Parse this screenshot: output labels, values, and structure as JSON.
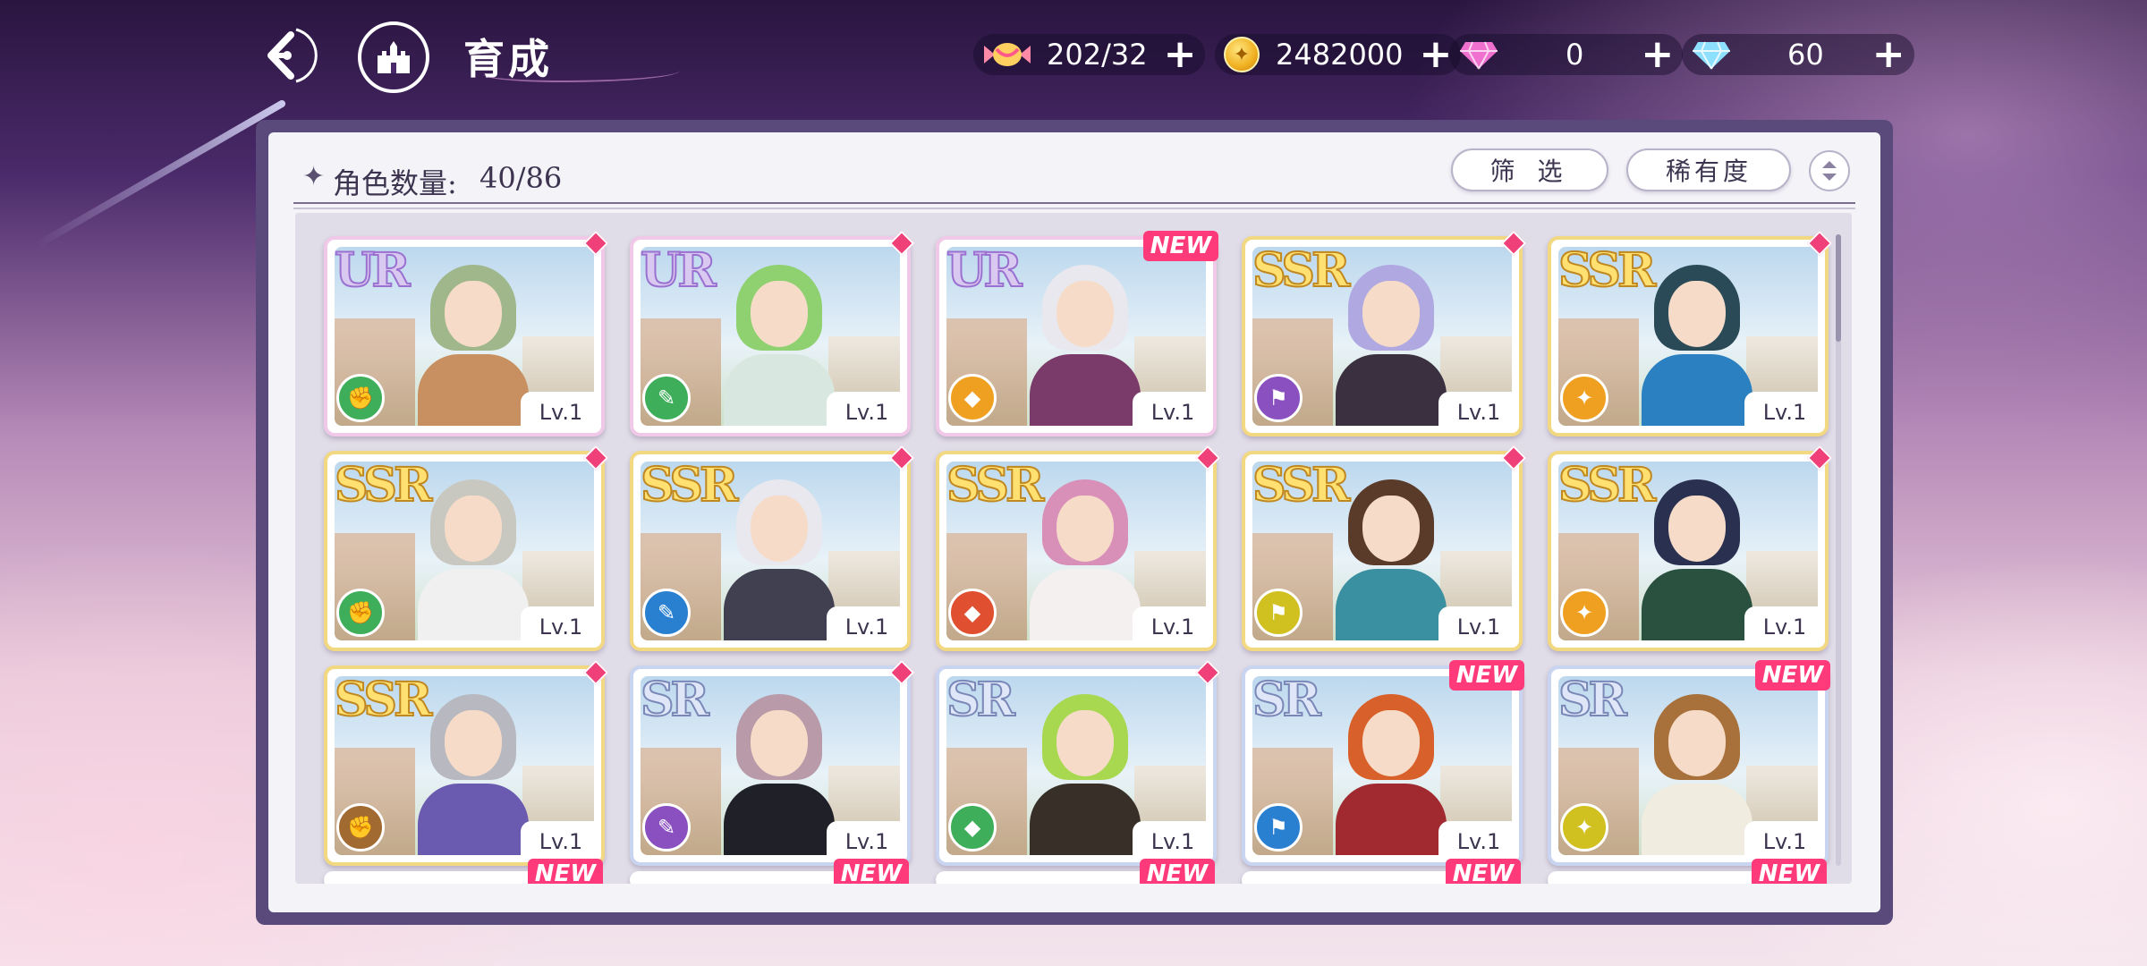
{
  "header": {
    "title": "育成",
    "resources": [
      {
        "name": "candy",
        "value": "202/32"
      },
      {
        "name": "coin",
        "value": "2482000"
      },
      {
        "name": "pink-gem",
        "value": "0"
      },
      {
        "name": "diamond",
        "value": "60"
      }
    ]
  },
  "panel": {
    "count_label": "角色数量:",
    "count_value": "40/86",
    "filter_label": "筛 选",
    "rarity_label": "稀有度"
  },
  "colors": {
    "ur_frame": "#f0c8e8",
    "ssr_frame": "#f2d880",
    "sr_frame": "#c8d4f0",
    "new_badge": "#ff3a7a"
  },
  "cards": [
    {
      "rarity": "UR",
      "level": "Lv.1",
      "hair": "#9fb78a",
      "body": "#c89060",
      "type_color": "#3fae5a",
      "marker": "gem"
    },
    {
      "rarity": "UR",
      "level": "Lv.1",
      "hair": "#8fd070",
      "body": "#d8e8e0",
      "type_color": "#3fae5a",
      "marker": "gem"
    },
    {
      "rarity": "UR",
      "level": "Lv.1",
      "hair": "#e8e8ee",
      "body": "#7a3a6a",
      "type_color": "#f0a020",
      "marker": "NEW"
    },
    {
      "rarity": "SSR",
      "level": "Lv.1",
      "hair": "#b0a8e0",
      "body": "#3a3040",
      "type_color": "#8a50c0",
      "marker": "gem"
    },
    {
      "rarity": "SSR",
      "level": "Lv.1",
      "hair": "#2a4a58",
      "body": "#2a80c0",
      "type_color": "#f0a020",
      "marker": "gem"
    },
    {
      "rarity": "SSR",
      "level": "Lv.1",
      "hair": "#c8c8c0",
      "body": "#f0f0f0",
      "type_color": "#3fae5a",
      "marker": "gem"
    },
    {
      "rarity": "SSR",
      "level": "Lv.1",
      "hair": "#e8e8ee",
      "body": "#404050",
      "type_color": "#2a80d0",
      "marker": "gem"
    },
    {
      "rarity": "SSR",
      "level": "Lv.1",
      "hair": "#d890b8",
      "body": "#f4f0f0",
      "type_color": "#e05030",
      "marker": "gem"
    },
    {
      "rarity": "SSR",
      "level": "Lv.1",
      "hair": "#5a3a28",
      "body": "#3a90a0",
      "type_color": "#d0c020",
      "marker": "gem"
    },
    {
      "rarity": "SSR",
      "level": "Lv.1",
      "hair": "#2a3050",
      "body": "#2a5040",
      "type_color": "#f0a020",
      "marker": "gem"
    },
    {
      "rarity": "SSR",
      "level": "Lv.1",
      "hair": "#b8b8c0",
      "body": "#6a5ab0",
      "type_color": "#a06a30",
      "marker": "gem"
    },
    {
      "rarity": "SR",
      "level": "Lv.1",
      "hair": "#b89aa8",
      "body": "#202028",
      "type_color": "#8a50c0",
      "marker": "gem"
    },
    {
      "rarity": "SR",
      "level": "Lv.1",
      "hair": "#a8d850",
      "body": "#383028",
      "type_color": "#3fae5a",
      "marker": "gem"
    },
    {
      "rarity": "SR",
      "level": "Lv.1",
      "hair": "#d8602a",
      "body": "#a02a30",
      "type_color": "#2a80d0",
      "marker": "NEW"
    },
    {
      "rarity": "SR",
      "level": "Lv.1",
      "hair": "#a8703a",
      "body": "#f0ece0",
      "type_color": "#d0c020",
      "marker": "NEW"
    }
  ],
  "next_row_markers": [
    "NEW",
    "NEW",
    "NEW",
    "NEW",
    "NEW"
  ]
}
